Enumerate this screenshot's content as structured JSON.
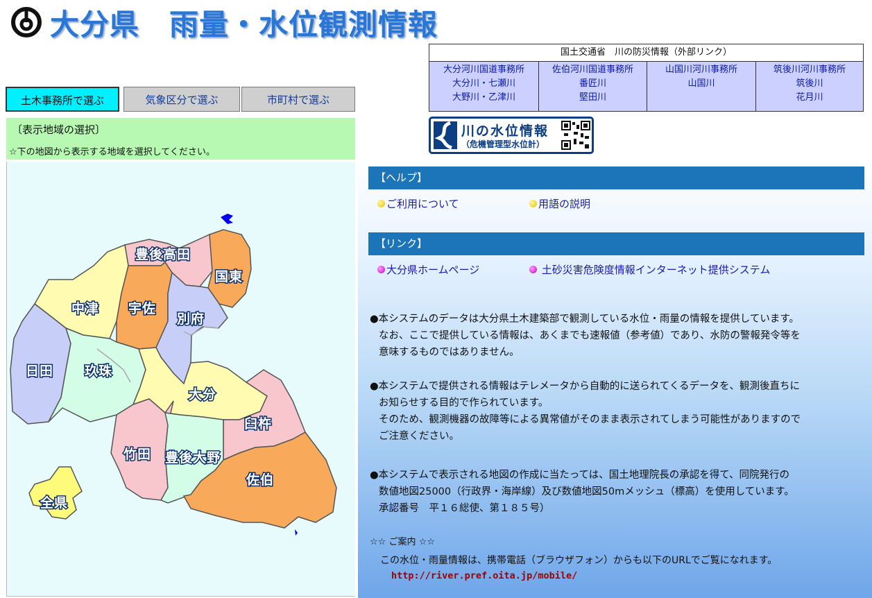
{
  "header": {
    "title": "大分県　雨量・水位観測情報"
  },
  "tabs": [
    {
      "label": "土木事務所で選ぶ"
    },
    {
      "label": "気象区分で選ぶ"
    },
    {
      "label": "市町村で選ぶ"
    }
  ],
  "selection": {
    "title": "〔表示地域の選択〕",
    "instruction": "☆下の地図から表示する地域を選択してください。"
  },
  "map": {
    "regions": [
      {
        "label": "豊後高田",
        "color": "#f8c7cd"
      },
      {
        "label": "国東",
        "color": "#f8a95a"
      },
      {
        "label": "中津",
        "color": "#fffbb0"
      },
      {
        "label": "宇佐",
        "color": "#f8a95a"
      },
      {
        "label": "別府",
        "color": "#c7cef8"
      },
      {
        "label": "日田",
        "color": "#c7cef8"
      },
      {
        "label": "玖珠",
        "color": "#d3fde7"
      },
      {
        "label": "大分",
        "color": "#fffbb0"
      },
      {
        "label": "臼杵",
        "color": "#f8c7cd"
      },
      {
        "label": "竹田",
        "color": "#f8c7cd"
      },
      {
        "label": "豊後大野",
        "color": "#d3fde7"
      },
      {
        "label": "佐伯",
        "color": "#f8a95a"
      },
      {
        "label": "全県",
        "color": "#fffb7a"
      }
    ]
  },
  "mlit": {
    "title": "国土交通省　川の防災情報（外部リンク）",
    "offices": [
      {
        "name": "大分河川国道事務所",
        "rivers": [
          "大分川・七瀬川",
          "大野川・乙津川"
        ]
      },
      {
        "name": "佐伯河川国道事務所",
        "rivers": [
          "番匠川",
          "堅田川"
        ]
      },
      {
        "name": "山国川河川事務所",
        "rivers": [
          "山国川"
        ]
      },
      {
        "name": "筑後川河川事務所",
        "rivers": [
          "筑後川",
          "花月川"
        ]
      }
    ]
  },
  "banner": {
    "main": "川の水位情報",
    "sub": "（危機管理型水位計）"
  },
  "help": {
    "header": "【ヘルプ】",
    "links": [
      "ご利用について",
      "用語の説明"
    ]
  },
  "links": {
    "header": "【リンク】",
    "items": [
      "大分県ホームページ",
      "土砂災害危険度情報インターネット提供システム"
    ]
  },
  "notices": [
    [
      "●本システムのデータは大分県土木建築部で観測している水位・雨量の情報を提供しています。",
      "なお、ここで提供している情報は、あくまでも速報値（参考値）であり、水防の警報発令等を",
      "意味するものではありません。"
    ],
    [
      "●本システムで提供される情報はテレメータから自動的に送られてくるデータを、観測後直ちに",
      "お知らせする目的で作られています。",
      "そのため、観測機器の故障等による異常値がそのまま表示されてしまう可能性がありますので",
      "ご注意ください。"
    ],
    [
      "●本システムで表示される地図の作成に当たっては、国土地理院長の承認を得て、同院発行の",
      "数値地図25000（行政界・海岸線）及び数値地図50mメッシュ（標高）を使用しています。",
      "承認番号　平１６総使、第１８５号）"
    ]
  ],
  "guide": {
    "title": "☆☆ ご案内 ☆☆",
    "text": "この水位・雨量情報は、携帯電話（ブラウザフォン）からも以下のURLでご覧になれます。",
    "url": "http://river.pref.oita.jp/mobile/"
  },
  "icons": {
    "logo": "oita-prefecture-emblem-icon",
    "qr": "qr-code-icon",
    "river": "river-wave-icon"
  }
}
